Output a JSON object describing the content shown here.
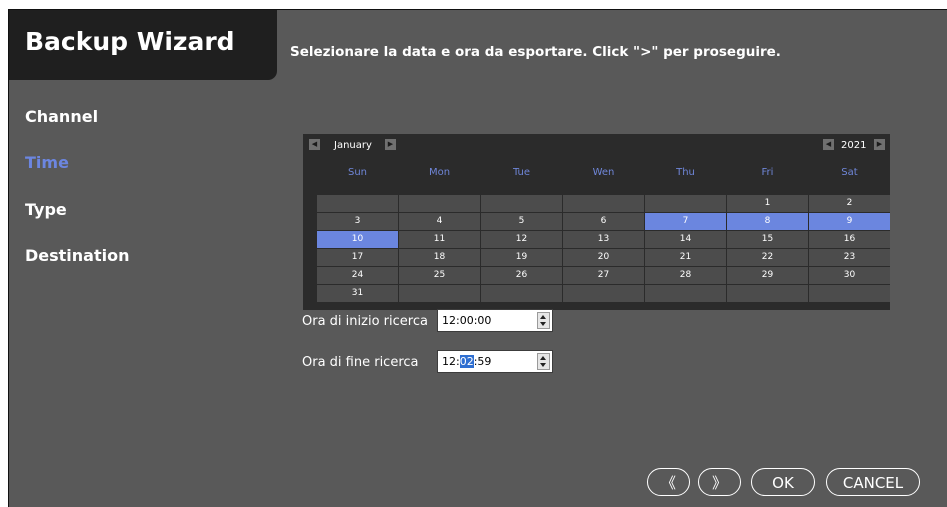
{
  "title": "Backup Wizard",
  "instruction": "Selezionare la data e ora da esportare. Click \">\" per proseguire.",
  "nav": [
    "Channel",
    "Time",
    "Type",
    "Destination"
  ],
  "active_nav": "Time",
  "calendar": {
    "month": "January",
    "year": "2021",
    "prev_month_icon": "◀",
    "next_month_icon": "▶",
    "prev_year_icon": "◀",
    "next_year_icon": "▶",
    "days_of_week": [
      "Sun",
      "Mon",
      "Tue",
      "Wen",
      "Thu",
      "Fri",
      "Sat"
    ],
    "weeks": [
      [
        "",
        "",
        "",
        "",
        "",
        "1",
        "2"
      ],
      [
        "3",
        "4",
        "5",
        "6",
        "7",
        "8",
        "9"
      ],
      [
        "10",
        "11",
        "12",
        "13",
        "14",
        "15",
        "16"
      ],
      [
        "17",
        "18",
        "19",
        "20",
        "21",
        "22",
        "23"
      ],
      [
        "24",
        "25",
        "26",
        "27",
        "28",
        "29",
        "30"
      ],
      [
        "31",
        "",
        "",
        "",
        "",
        "",
        ""
      ]
    ],
    "selected_days": [
      "7",
      "8",
      "9",
      "10"
    ]
  },
  "start_time": {
    "label": "Ora di inizio ricerca",
    "value": "12:00:00"
  },
  "end_time": {
    "label": "Ora di fine ricerca",
    "value_pre": "12:",
    "value_sel": "02",
    "value_post": ":59"
  },
  "buttons": {
    "prev": "《",
    "next": "》",
    "ok": "OK",
    "cancel": "CANCEL"
  },
  "colors": {
    "background": "#595959",
    "title_bar": "#1f1f1f",
    "accent": "#6b86df",
    "calendar_bg": "#2b2b2b",
    "cell_bg": "#4c4c4c"
  }
}
